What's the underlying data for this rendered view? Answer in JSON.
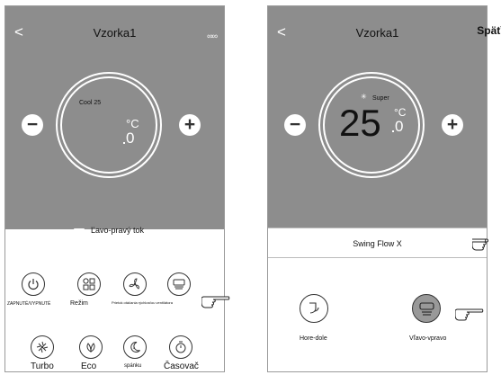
{
  "left_screen": {
    "title": "Vzorka1",
    "back_glyph": "<",
    "more_glyph": "∞∞",
    "mode_text": "Cool 25",
    "temp_unit": "°C",
    "temp_decimal": "0",
    "minus_glyph": "−",
    "plus_glyph": "+",
    "flow_label": "Ľavo-pravý tok",
    "buttons": [
      {
        "icon": "power-icon",
        "label": "ZAPNUTÉ/VYPNUTÉ"
      },
      {
        "icon": "mode-grid-icon",
        "label": "Režim"
      },
      {
        "icon": "fan-icon",
        "label": "Prietok otáčania rýchlosťou ventilátora"
      },
      {
        "icon": "swing-louver-icon",
        "label": ""
      },
      {
        "icon": "turbo-fan-icon",
        "label": "Turbo"
      },
      {
        "icon": "eco-leaf-icon",
        "label": "Eco"
      },
      {
        "icon": "sleep-moon-icon",
        "label": "spánku"
      },
      {
        "icon": "timer-icon",
        "label": "Časovač"
      }
    ]
  },
  "right_screen": {
    "title": "Vzorka1",
    "back_glyph": "<",
    "back_text": "Späť",
    "mode_text": "Super",
    "temp_value": "25",
    "temp_unit": "°C",
    "temp_decimal": "0",
    "minus_glyph": "−",
    "plus_glyph": "+",
    "swing_title": "Swing Flow X",
    "options": [
      {
        "icon": "up-down-swing-icon",
        "label": "Hore-dole",
        "selected": false
      },
      {
        "icon": "left-right-swing-icon",
        "label": "Vľavo-vpravo",
        "selected": true
      }
    ]
  },
  "colors": {
    "panel_gray": "#8d8d8d",
    "selected_gray": "#999999"
  }
}
